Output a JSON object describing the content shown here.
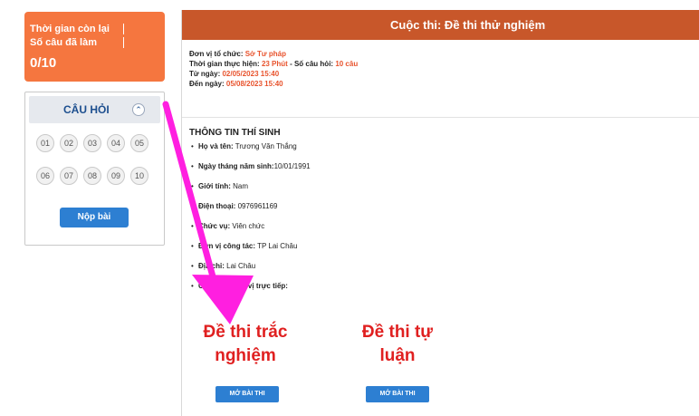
{
  "status": {
    "time_left_label": "Thời gian còn lại",
    "answered_label": "Số câu đã làm",
    "answered_count": "0/10"
  },
  "questions": {
    "header": "CÂU HỎI",
    "toggle_icon": "chevron-up-icon",
    "numbers": [
      "01",
      "02",
      "03",
      "04",
      "05",
      "06",
      "07",
      "08",
      "09",
      "10"
    ],
    "submit_label": "Nộp bài"
  },
  "contest": {
    "title": "Cuộc thi: Đề thi thử nghiệm",
    "organizer_label": "Đơn vị tổ chức:",
    "organizer": "Sở Tư pháp",
    "duration_label": "Thời gian thực hiện:",
    "duration": "23 Phút",
    "question_count_label": "- Số câu hỏi:",
    "question_count": "10 câu",
    "from_label": "Từ ngày:",
    "from": "02/05/2023 15:40",
    "to_label": "Đến ngày:",
    "to": "05/08/2023 15:40"
  },
  "candidate": {
    "title": "THÔNG TIN THÍ SINH",
    "name_label": "Họ và tên:",
    "name": "Trương Văn Thắng",
    "dob_label": "Ngày tháng năm sinh:",
    "dob": "10/01/1991",
    "gender_label": "Giới tính:",
    "gender": "Nam",
    "phone_label": "Điện thoại:",
    "phone": "0976961169",
    "position_label": "Chức vụ:",
    "position": "Viên chức",
    "workplace_label": "Đơn vị công tác:",
    "workplace": "TP Lai Châu",
    "address_label": "Địa chỉ:",
    "address": "Lai Châu",
    "direct_unit_label": "Cơ quan, đơn vị trực tiếp:"
  },
  "exams": {
    "multiple_choice_line1": "Đề thi trắc",
    "multiple_choice_line2": "nghiệm",
    "essay_line1": "Đề thi tự",
    "essay_line2": "luận",
    "open_label": "MỞ BÀI THI"
  },
  "colors": {
    "accent_orange": "#f5763f",
    "header_brown": "#c8572a",
    "button_blue": "#2d7fd2",
    "highlight_red": "#e02020",
    "arrow_magenta": "#ff1fe0"
  }
}
